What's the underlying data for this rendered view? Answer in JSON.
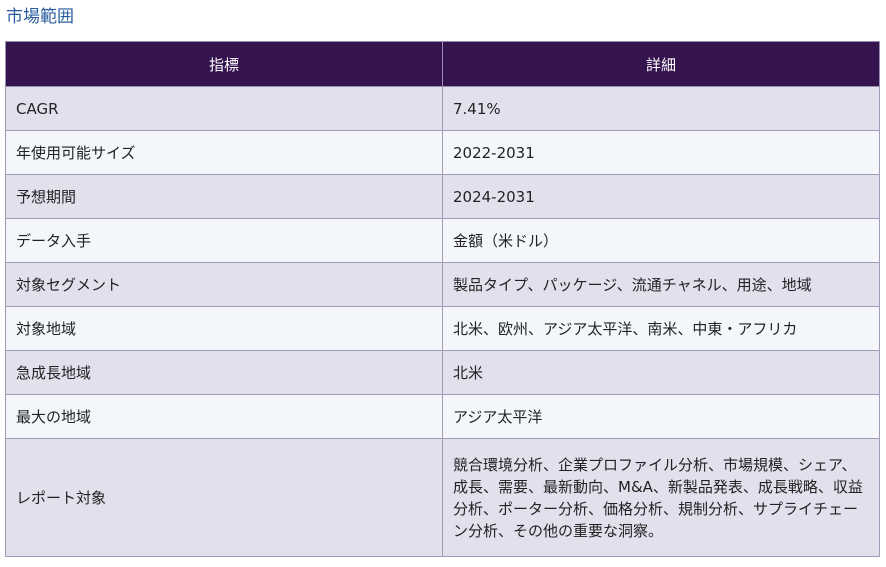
{
  "heading": "市場範囲",
  "table": {
    "headers": [
      "指標",
      "詳細"
    ],
    "rows": [
      {
        "metric": "CAGR",
        "detail": "7.41%"
      },
      {
        "metric": "年使用可能サイズ",
        "detail": "2022-2031"
      },
      {
        "metric": "予想期間",
        "detail": "2024-2031"
      },
      {
        "metric": "データ入手",
        "detail": "金額（米ドル）"
      },
      {
        "metric": "対象セグメント",
        "detail": "製品タイプ、パッケージ、流通チャネル、用途、地域"
      },
      {
        "metric": "対象地域",
        "detail": "北米、欧州、アジア太平洋、南米、中東・アフリカ"
      },
      {
        "metric": "急成長地域",
        "detail": "北米"
      },
      {
        "metric": "最大の地域",
        "detail": "アジア太平洋"
      },
      {
        "metric": "レポート対象",
        "detail": "競合環境分析、企業プロファイル分析、市場規模、シェア、成長、需要、最新動向、M&A、新製品発表、成長戦略、収益分析、ポーター分析、価格分析、規制分析、サプライチェーン分析、その他の重要な洞察。"
      }
    ]
  },
  "colors": {
    "header_bg": "#35134f",
    "row_odd_bg": "#e3e0ee",
    "row_even_bg": "#f4f7fa",
    "heading_text": "#2a5d9f"
  }
}
